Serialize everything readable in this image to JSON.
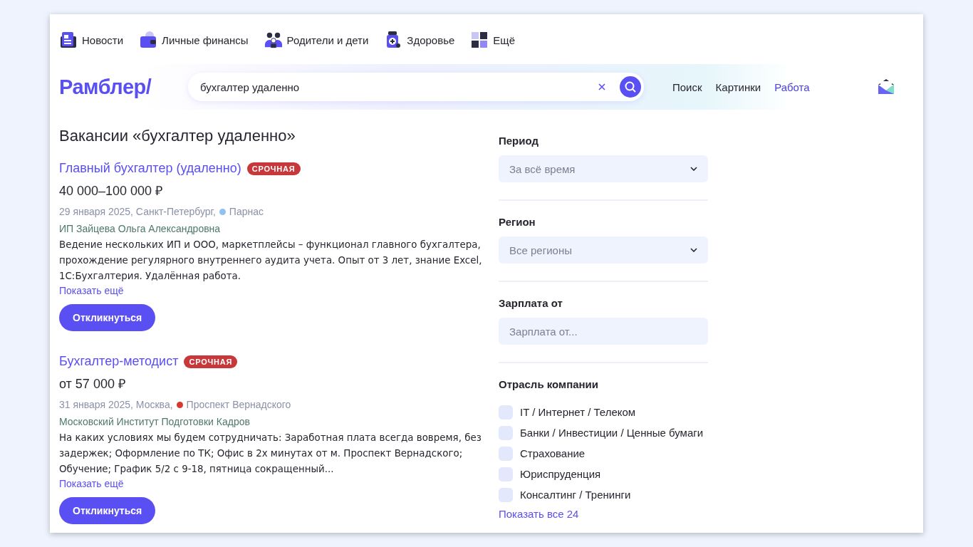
{
  "top_nav": [
    {
      "kind": "news",
      "label": "Новости"
    },
    {
      "kind": "finance",
      "label": "Личные финансы"
    },
    {
      "kind": "family",
      "label": "Родители и дети"
    },
    {
      "kind": "health",
      "label": "Здоровье"
    },
    {
      "kind": "more",
      "label": "Ещё"
    }
  ],
  "header": {
    "logo": "Рамблер/",
    "search": {
      "value": "бухгалтер удаленно"
    },
    "links": [
      {
        "label": "Поиск",
        "selected": false
      },
      {
        "label": "Картинки",
        "selected": false
      },
      {
        "label": "Работа",
        "selected": true
      }
    ]
  },
  "heading": "Вакансии «бухгалтер удаленно»",
  "vacancies": [
    {
      "title": "Главный бухгалтер (удаленно)",
      "badge": "СРОЧНАЯ",
      "salary": "40 000–100 000 ₽",
      "date_city": "29 января 2025, Санкт-Петербург,",
      "metro": {
        "name": "Парнас",
        "color": "#8fc2f0"
      },
      "company": "ИП Зайцева Ольга Александровна",
      "description": "Ведение нескольких ИП и ООО, маркетплейсы – функционал главного бухгалтера, прохождение регулярного внутреннего аудита учета. Опыт от 3 лет, знание Excel, 1С:Бухгалтерия. Удалённая работа.",
      "more": "Показать ещё",
      "button": "Откликнуться"
    },
    {
      "title": "Бухгалтер-методист",
      "badge": "СРОЧНАЯ",
      "salary": "от 57 000 ₽",
      "date_city": "31 января 2025, Москва,",
      "metro": {
        "name": "Проспект Вернадского",
        "color": "#d8392f"
      },
      "company": "Московский Институт Подготовки Кадров",
      "description": "На каких условиях мы будем сотрудничать: Заработная плата всегда вовремя, без задержек; Оформление по ТК; Офис в 2х минутах от м. Проспект Вернадского; Обучение; График 5/2 с 9-18, пятница сокращенный...",
      "more": "Показать ещё",
      "button": "Откликнуться"
    }
  ],
  "filters": {
    "period": {
      "label": "Период",
      "value": "За всё время"
    },
    "region": {
      "label": "Регион",
      "value": "Все регионы"
    },
    "salary": {
      "label": "Зарплата от",
      "placeholder": "Зарплата от..."
    },
    "industry": {
      "label": "Отрасль компании",
      "options": [
        {
          "label": "IT / Интернет / Телеком",
          "checked": false
        },
        {
          "label": "Банки / Инвестиции / Ценные бумаги",
          "checked": false
        },
        {
          "label": "Страхование",
          "checked": false
        },
        {
          "label": "Юриспруденция",
          "checked": false
        },
        {
          "label": "Консалтинг / Тренинги",
          "checked": false
        }
      ],
      "show_all": "Показать все 24"
    }
  }
}
